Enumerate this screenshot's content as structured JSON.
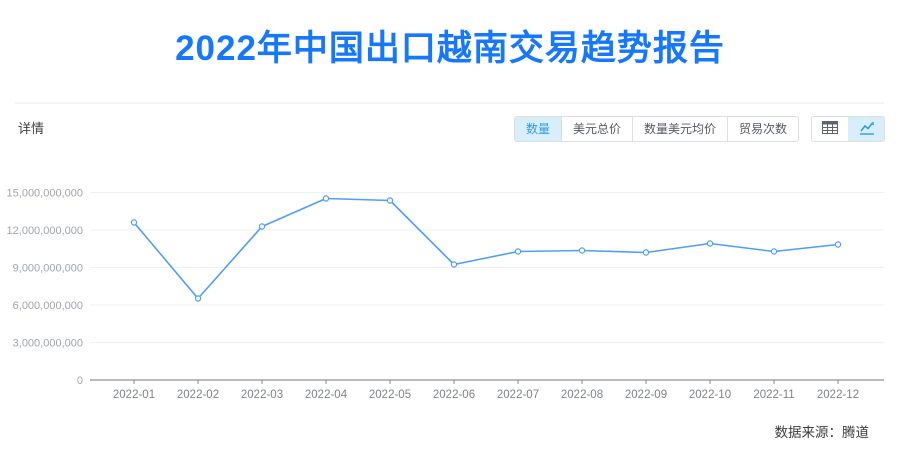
{
  "page": {
    "title": "2022年中国出口越南交易趋势报告",
    "section_label": "详情",
    "source_label": "数据来源：腾道"
  },
  "toolbar": {
    "metric_tabs": [
      {
        "label": "数量",
        "active": true
      },
      {
        "label": "美元总价",
        "active": false
      },
      {
        "label": "数量美元均价",
        "active": false
      },
      {
        "label": "贸易次数",
        "active": false
      }
    ],
    "view_toggles": [
      {
        "icon": "table-icon",
        "active": false
      },
      {
        "icon": "line-chart-icon",
        "active": true
      }
    ]
  },
  "colors": {
    "accent_blue": "#1677ff",
    "tab_active_bg": "#d8eefb",
    "tab_active_text": "#309ce2",
    "line_blue": "#4f9ef8"
  },
  "chart_data": {
    "type": "line",
    "title": "",
    "xlabel": "",
    "ylabel": "",
    "categories": [
      "2022-01",
      "2022-02",
      "2022-03",
      "2022-04",
      "2022-05",
      "2022-06",
      "2022-07",
      "2022-08",
      "2022-09",
      "2022-10",
      "2022-11",
      "2022-12"
    ],
    "series": [
      {
        "name": "数量",
        "values": [
          12600000000,
          6520000000,
          12280000000,
          14520000000,
          14360000000,
          9240000000,
          10280000000,
          10360000000,
          10200000000,
          10920000000,
          10280000000,
          10840000000
        ]
      }
    ],
    "ylim": [
      0,
      15000000000
    ],
    "y_ticks": [
      0,
      3000000000,
      6000000000,
      9000000000,
      12000000000,
      15000000000
    ],
    "grid": true,
    "legend_position": "none",
    "marker": "hollow-circle"
  }
}
